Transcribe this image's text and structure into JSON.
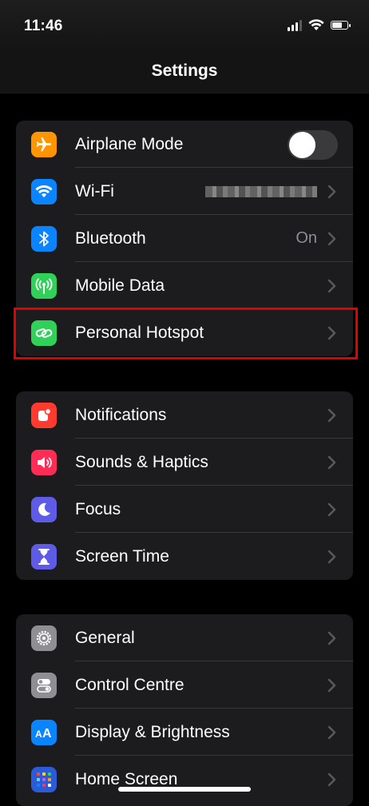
{
  "status": {
    "time": "11:46"
  },
  "nav": {
    "title": "Settings"
  },
  "group1": {
    "airplane": {
      "label": "Airplane Mode",
      "icon": "airplane-icon",
      "color": "#ff9500",
      "toggle_on": false
    },
    "wifi": {
      "label": "Wi-Fi",
      "icon": "wifi-icon",
      "color": "#0a84ff"
    },
    "bluetooth": {
      "label": "Bluetooth",
      "value": "On",
      "icon": "bluetooth-icon",
      "color": "#0a84ff"
    },
    "mobile": {
      "label": "Mobile Data",
      "icon": "antenna-icon",
      "color": "#30d158"
    },
    "hotspot": {
      "label": "Personal Hotspot",
      "icon": "hotspot-icon",
      "color": "#30d158"
    }
  },
  "group2": {
    "notifications": {
      "label": "Notifications",
      "icon": "bell-icon",
      "color": "#ff3b30"
    },
    "sounds": {
      "label": "Sounds & Haptics",
      "icon": "speaker-icon",
      "color": "#ff2d55"
    },
    "focus": {
      "label": "Focus",
      "icon": "moon-icon",
      "color": "#5e5ce6"
    },
    "screentime": {
      "label": "Screen Time",
      "icon": "hourglass-icon",
      "color": "#5e5ce6"
    }
  },
  "group3": {
    "general": {
      "label": "General",
      "icon": "gear-icon",
      "color": "#8e8e93"
    },
    "control": {
      "label": "Control Centre",
      "icon": "switches-icon",
      "color": "#8e8e93"
    },
    "display": {
      "label": "Display & Brightness",
      "icon": "text-size-icon",
      "color": "#0a84ff"
    },
    "home": {
      "label": "Home Screen",
      "icon": "home-grid-icon",
      "color": "#2c5bd8"
    }
  },
  "highlight_color": "#e30000"
}
